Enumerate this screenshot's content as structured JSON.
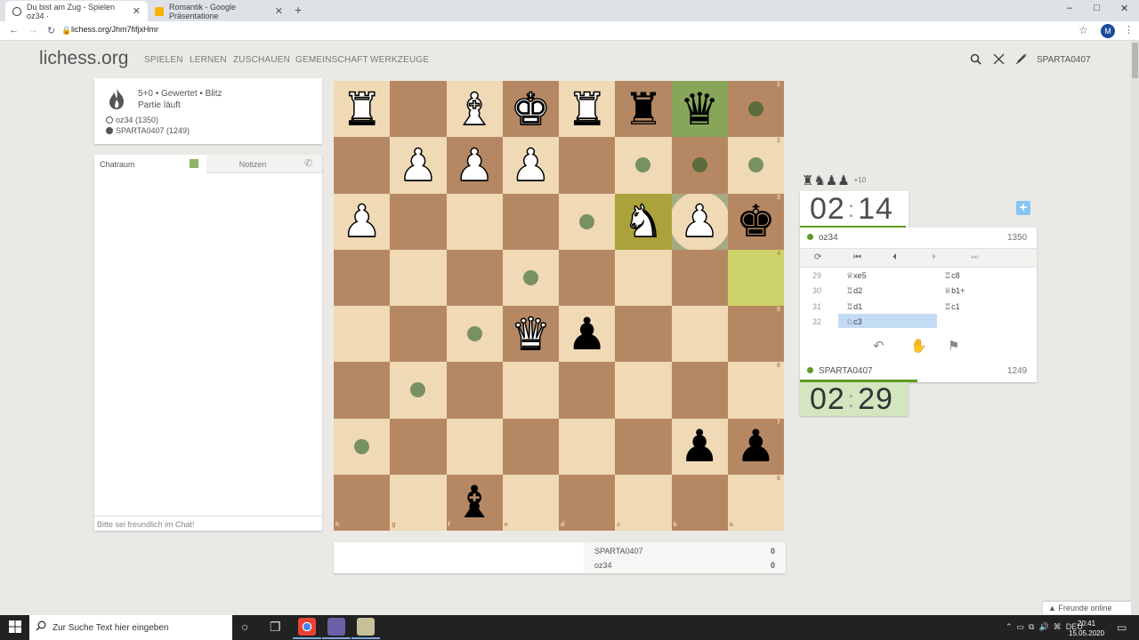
{
  "browser": {
    "tabs": [
      {
        "title": "Du bist am Zug - Spielen oz34 ·",
        "active": true,
        "favicon_color": "#333333"
      },
      {
        "title": "Romantik - Google Präsentatione",
        "active": false,
        "favicon_color": "#f4b400"
      }
    ],
    "new_tab_glyph": "+",
    "url": "lichess.org/Jhm7fifjxHmr",
    "profile_initial": "M",
    "window_controls": [
      "–",
      "□",
      "✕"
    ]
  },
  "site": {
    "logo": "lichess.org",
    "nav": [
      "SPIELEN",
      "LERNEN",
      "ZUSCHAUEN",
      "GEMEINSCHAFT",
      "WERKZEUGE"
    ],
    "username": "SPARTA0407"
  },
  "game_info": {
    "setup": "5+0 • Gewertet • Blitz",
    "status": "Partie läuft",
    "white_player": "oz34 (1350)",
    "black_player": "SPARTA0407 (1249)"
  },
  "chat": {
    "tab_room": "Chatraum",
    "tab_notes": "Notizen",
    "placeholder": "Bitte sei freundlich im Chat!"
  },
  "board": {
    "orientation": "black",
    "files_bottom": [
      "h",
      "g",
      "f",
      "e",
      "d",
      "c",
      "b",
      "a"
    ],
    "ranks_right": [
      "1",
      "2",
      "3",
      "4",
      "5",
      "6",
      "7",
      "8"
    ],
    "pieces": [
      {
        "row": 0,
        "col": 0,
        "glyph": "♜",
        "color": "w",
        "name": "white-rook"
      },
      {
        "row": 0,
        "col": 2,
        "glyph": "♝",
        "color": "w",
        "name": "white-bishop"
      },
      {
        "row": 0,
        "col": 3,
        "glyph": "♚",
        "color": "w",
        "name": "white-king"
      },
      {
        "row": 0,
        "col": 4,
        "glyph": "♜",
        "color": "w",
        "name": "white-rook"
      },
      {
        "row": 0,
        "col": 5,
        "glyph": "♜",
        "color": "b",
        "name": "black-rook"
      },
      {
        "row": 0,
        "col": 6,
        "glyph": "♛",
        "color": "b",
        "name": "black-queen"
      },
      {
        "row": 1,
        "col": 1,
        "glyph": "♟",
        "color": "w",
        "name": "white-pawn"
      },
      {
        "row": 1,
        "col": 2,
        "glyph": "♟",
        "color": "w",
        "name": "white-pawn"
      },
      {
        "row": 1,
        "col": 3,
        "glyph": "♟",
        "color": "w",
        "name": "white-pawn"
      },
      {
        "row": 2,
        "col": 0,
        "glyph": "♟",
        "color": "w",
        "name": "white-pawn"
      },
      {
        "row": 2,
        "col": 5,
        "glyph": "♞",
        "color": "w",
        "name": "white-knight"
      },
      {
        "row": 2,
        "col": 6,
        "glyph": "♟",
        "color": "w",
        "name": "white-pawn"
      },
      {
        "row": 2,
        "col": 7,
        "glyph": "♚",
        "color": "b",
        "name": "black-king"
      },
      {
        "row": 4,
        "col": 3,
        "glyph": "♛",
        "color": "w",
        "name": "white-queen"
      },
      {
        "row": 4,
        "col": 4,
        "glyph": "♟",
        "color": "b",
        "name": "black-pawn"
      },
      {
        "row": 6,
        "col": 6,
        "glyph": "♟",
        "color": "b",
        "name": "black-pawn"
      },
      {
        "row": 6,
        "col": 7,
        "glyph": "♟",
        "color": "b",
        "name": "black-pawn"
      },
      {
        "row": 7,
        "col": 2,
        "glyph": "♝",
        "color": "b",
        "name": "black-bishop"
      }
    ],
    "move_dots": [
      {
        "row": 0,
        "col": 7
      },
      {
        "row": 1,
        "col": 5
      },
      {
        "row": 1,
        "col": 6
      },
      {
        "row": 1,
        "col": 7
      },
      {
        "row": 2,
        "col": 4
      },
      {
        "row": 3,
        "col": 3
      },
      {
        "row": 4,
        "col": 2
      },
      {
        "row": 5,
        "col": 1
      },
      {
        "row": 6,
        "col": 0
      }
    ],
    "capture_rings": [
      {
        "row": 2,
        "col": 6
      }
    ],
    "selected_square": {
      "row": 0,
      "col": 6
    },
    "last_move": [
      {
        "row": 2,
        "col": 5
      },
      {
        "row": 3,
        "col": 7
      }
    ]
  },
  "scores": [
    {
      "name": "SPARTA0407",
      "score": "0"
    },
    {
      "name": "oz34",
      "score": "0"
    }
  ],
  "right": {
    "captured_glyphs": "♜♞♟♟",
    "material_diff": "+10",
    "clock_top": "02:14",
    "clock_bottom": "02:29",
    "top_player": {
      "name": "oz34",
      "rating": "1350"
    },
    "bottom_player": {
      "name": "SPARTA0407",
      "rating": "1249"
    },
    "moves": [
      {
        "num": "29",
        "white": "♕xe5",
        "black": "♖c8"
      },
      {
        "num": "30",
        "white": "♖d2",
        "black": "♕b1+"
      },
      {
        "num": "31",
        "white": "♖d1",
        "black": "♖c1"
      },
      {
        "num": "32",
        "white": "♘c3",
        "black": ""
      }
    ]
  },
  "friends_online": "Freunde online",
  "taskbar": {
    "search_placeholder": "Zur Suche Text hier eingeben",
    "language": "DEU",
    "time": "20:41",
    "date": "15.05.2020"
  }
}
